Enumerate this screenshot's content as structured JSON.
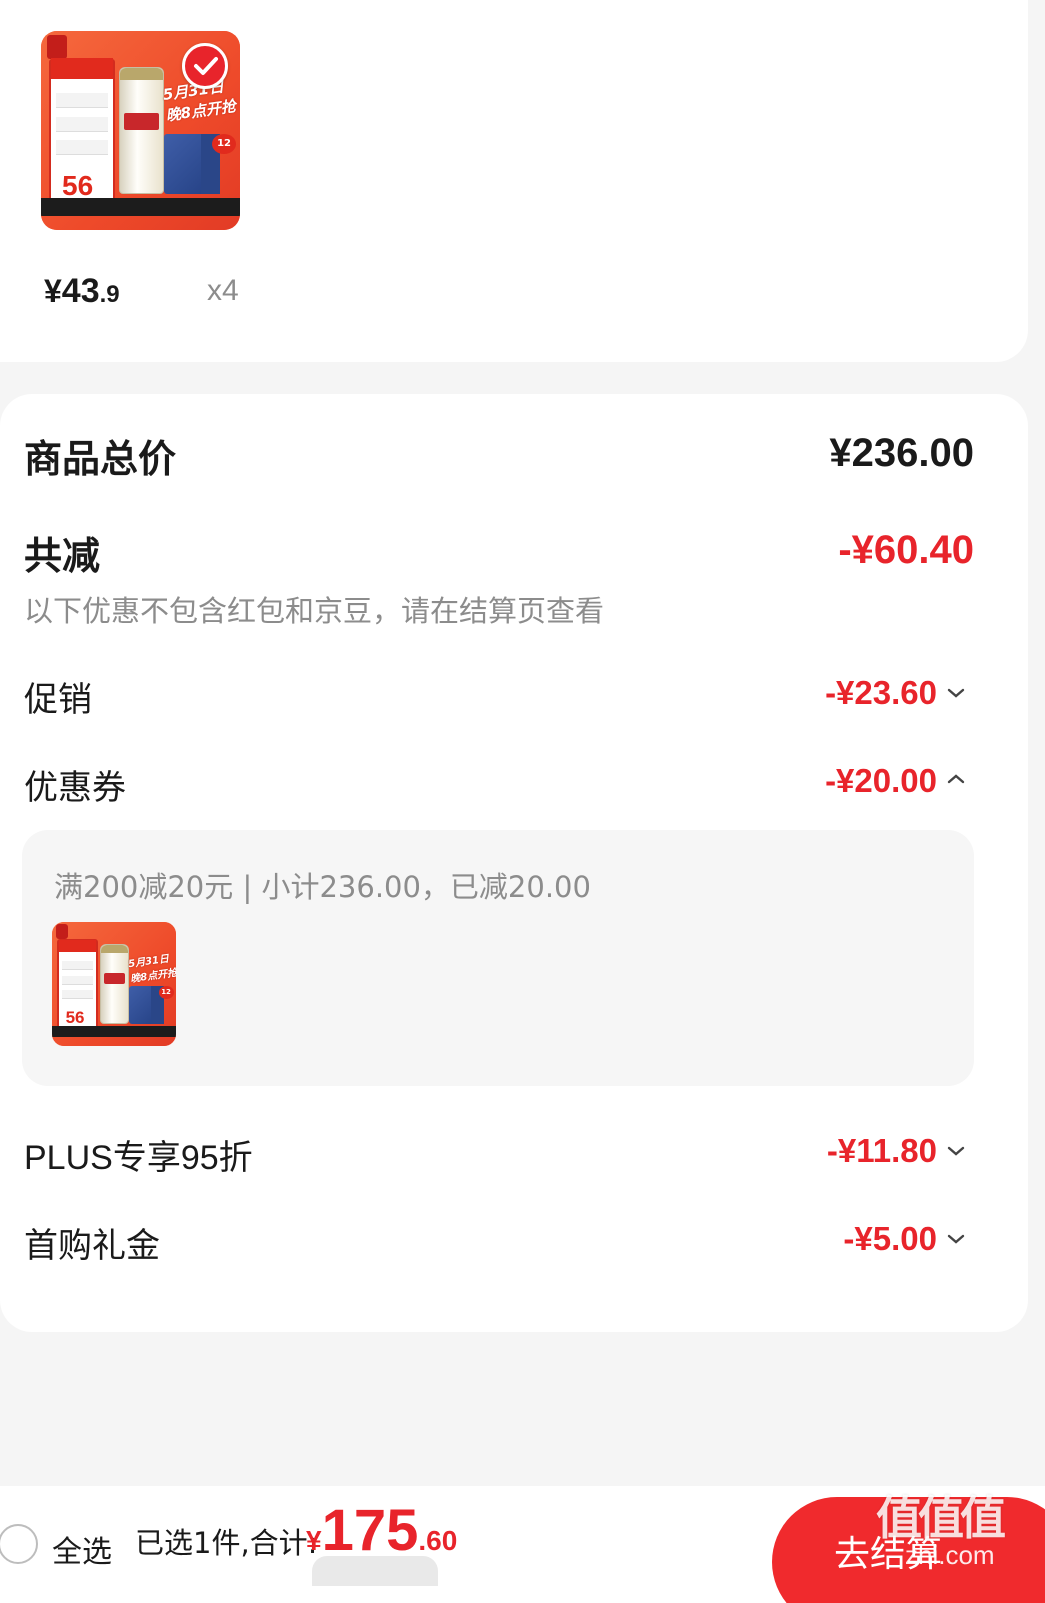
{
  "product": {
    "image_icon": "beer-product-image",
    "price_currency": "¥",
    "price_int": "43",
    "price_dec": ".9",
    "quantity": "x4"
  },
  "summary": {
    "total_label": "商品总价",
    "total_value": "¥236.00",
    "reduce_label": "共减",
    "reduce_value": "-¥60.40",
    "note": "以下优惠不包含红包和京豆，请在结算页查看",
    "rows": [
      {
        "label": "促销",
        "value": "-¥23.60",
        "chevron": "down"
      },
      {
        "label": "优惠券",
        "value": "-¥20.00",
        "chevron": "up"
      },
      {
        "label": "PLUS专享95折",
        "value": "-¥11.80",
        "chevron": "down"
      },
      {
        "label": "首购礼金",
        "value": "-¥5.00",
        "chevron": "down"
      }
    ],
    "coupon_detail": "满200减20元 | 小计236.00，已减20.00"
  },
  "bottom": {
    "select_all": "全选",
    "selected_text": "已选1件,合计:",
    "total_currency": "¥",
    "total_int": "175",
    "total_dec": ".60",
    "checkout_label": "去结算"
  },
  "watermark": {
    "text": "值值值",
    "url": "zhi.com"
  },
  "colors": {
    "accent": "#e8242b",
    "checkout": "#f02a2d",
    "muted": "#8c8c8c"
  }
}
